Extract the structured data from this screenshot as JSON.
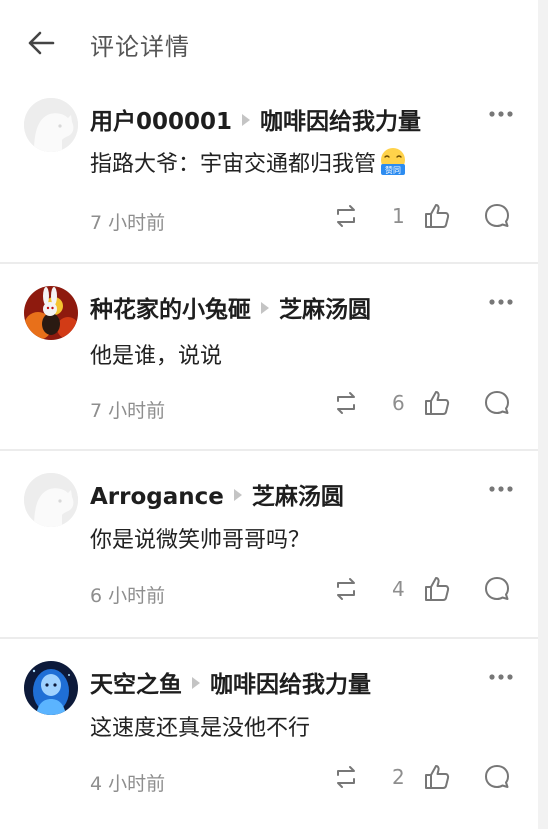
{
  "header": {
    "title": "评论详情"
  },
  "comments": [
    {
      "user": "用户000001",
      "reply_to": "咖啡因给我力量",
      "text": "指路大爷：宇宙交通都归我管",
      "emoji": "赞同",
      "time": "7 小时前",
      "likes": "1"
    },
    {
      "user": "种花家的小兔砸",
      "reply_to": "芝麻汤圆",
      "text": "他是谁，说说",
      "time": "7 小时前",
      "likes": "6"
    },
    {
      "user": "Arrogance",
      "reply_to": "芝麻汤圆",
      "text": "你是说微笑帅哥哥吗？",
      "time": "6 小时前",
      "likes": "4"
    },
    {
      "user": "天空之鱼",
      "reply_to": "咖啡因给我力量",
      "text": "这速度还真是没他不行",
      "time": "4 小时前",
      "likes": "2"
    }
  ],
  "colors": {
    "accent": "#1c1c1c",
    "muted": "#8e8e8e",
    "divider": "#ececec"
  }
}
